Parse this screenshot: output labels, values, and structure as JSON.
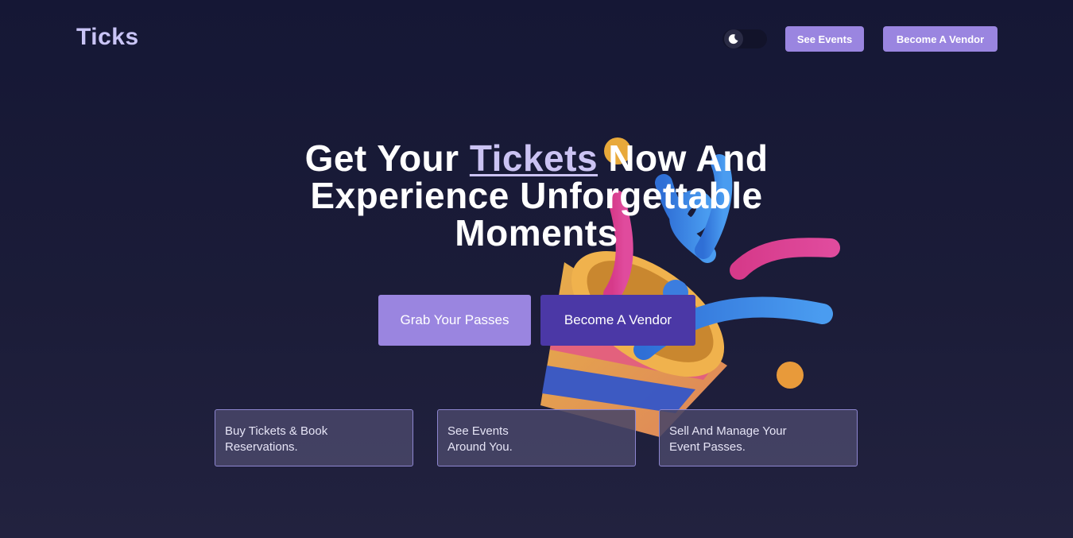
{
  "header": {
    "logo": "Ticks",
    "theme_toggle_icon": "moon-icon",
    "see_events_label": "See Events",
    "become_vendor_label": "Become A Vendor"
  },
  "hero": {
    "title_pre": "Get Your ",
    "title_accent": "Tickets",
    "title_post": " Now And Experience Unforgettable Moments",
    "illustration": "party-popper-confetti-image"
  },
  "cta": {
    "grab_label": "Grab Your Passes",
    "vendor_label": "Become A Vendor"
  },
  "features": [
    {
      "text": "Buy Tickets & Book\nReservations."
    },
    {
      "text": "See Events\nAround You."
    },
    {
      "text": "Sell And Manage Your\nEvent Passes."
    }
  ],
  "colors": {
    "background": "#151735",
    "accent": "#9a85e0",
    "accent_dark": "#4b38a6",
    "logo": "#c9c4f6"
  }
}
